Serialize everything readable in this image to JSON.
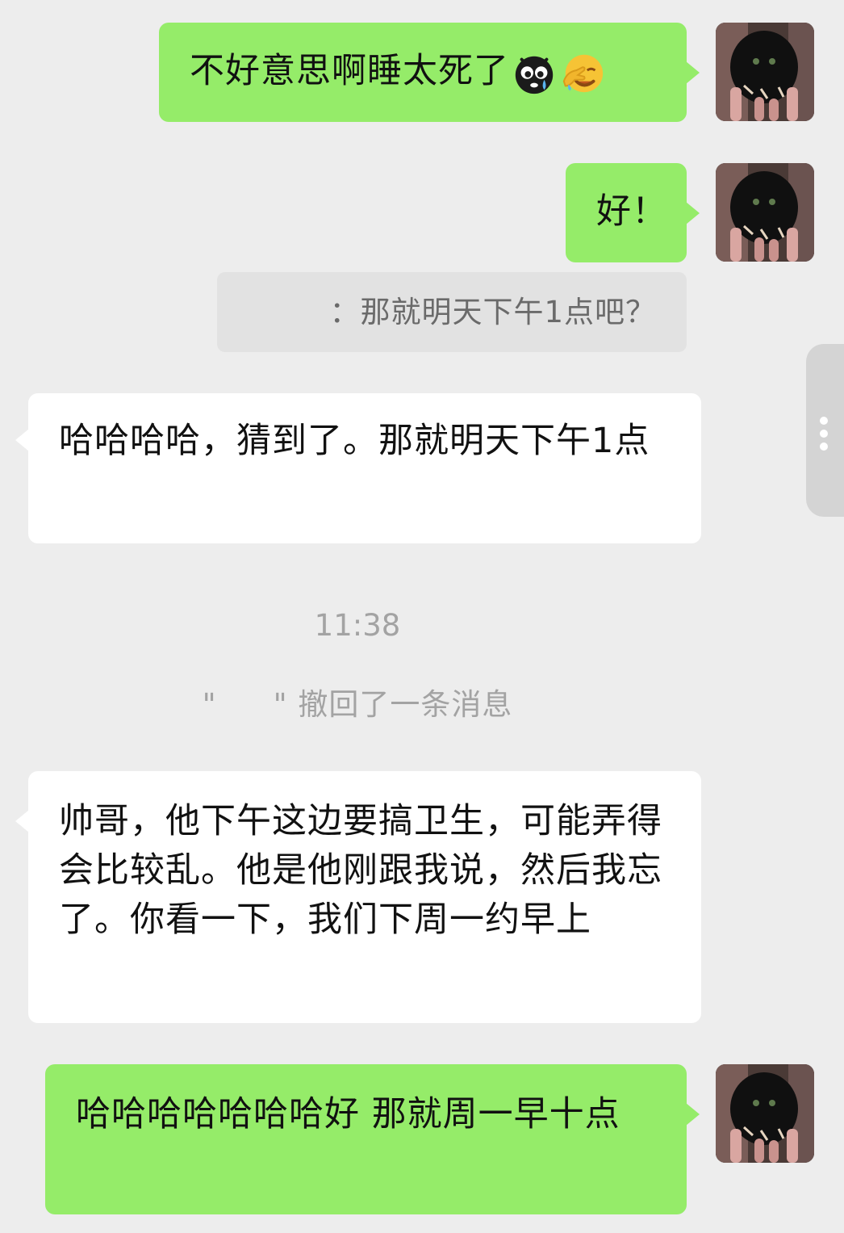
{
  "chat": {
    "messages": [
      {
        "side": "right",
        "text": "不好意思啊睡太死了",
        "emojis": [
          "crying-face-emoji",
          "facepalm-emoji"
        ]
      },
      {
        "side": "right",
        "text": "好！"
      },
      {
        "type": "quote",
        "text": "：那就明天下午1点吧？"
      },
      {
        "side": "left",
        "text": "哈哈哈哈，猜到了。那就明天下午1点"
      },
      {
        "type": "time",
        "text": "11:38"
      },
      {
        "type": "recall",
        "quote_open": "\"",
        "quote_close": "\"",
        "text": "撤回了一条消息"
      },
      {
        "side": "left",
        "text": "帅哥，他下午这边要搞卫生，可能弄得会比较乱。他是他刚跟我说，然后我忘了。你看一下，我们下周一约早上"
      },
      {
        "side": "right",
        "text": "哈哈哈哈哈哈哈好 那就周一早十点"
      }
    ]
  },
  "colors": {
    "background": "#ededed",
    "sent_bubble": "#95ec69",
    "received_bubble": "#ffffff",
    "quote_bg": "#e2e2e2",
    "system_text": "#a3a3a3"
  }
}
